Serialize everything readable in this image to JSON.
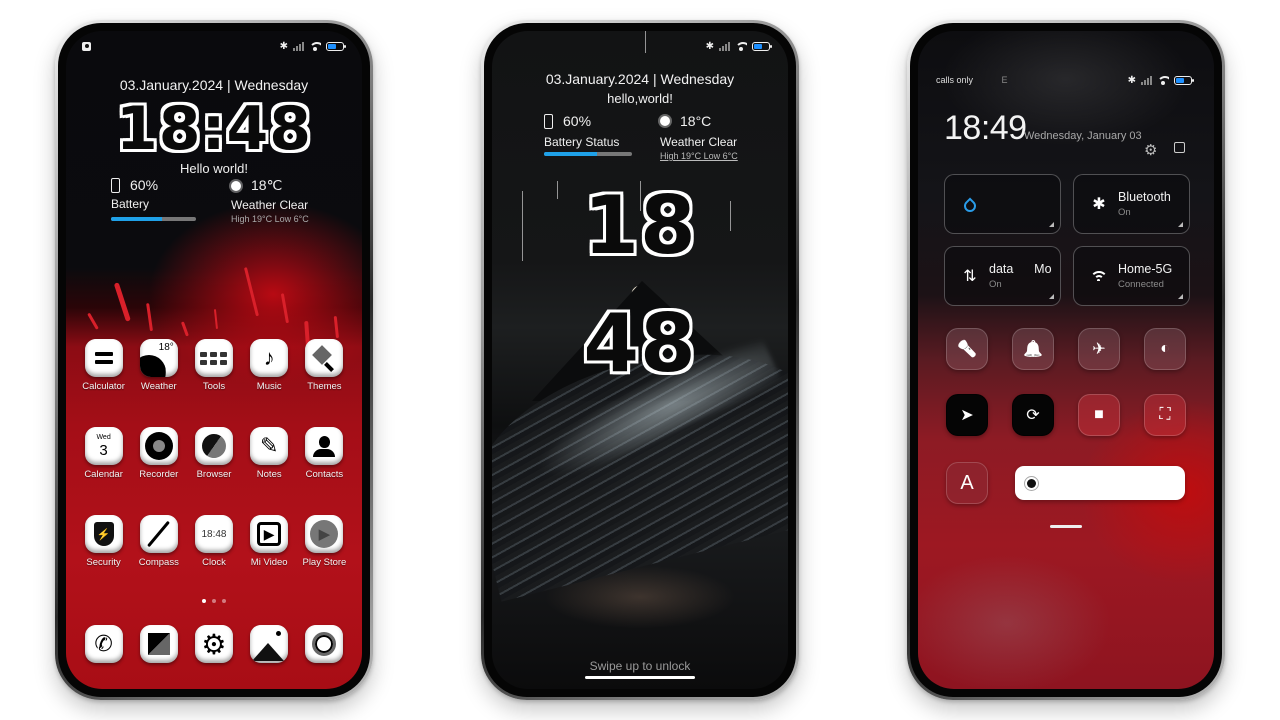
{
  "phones": {
    "home": {
      "date_line": "03.January.2024 | Wednesday",
      "time": {
        "hours": "18",
        "separator": ":",
        "minutes": "48"
      },
      "greeting": "Hello world!",
      "battery": {
        "percent_label": "60%",
        "label": "Battery",
        "level": 0.6
      },
      "weather": {
        "temp": "18℃",
        "condition": "Weather Clear",
        "high_low": "High 19°C  Low 6°C"
      },
      "apps": [
        {
          "label": "Calculator",
          "icon": "calculator-icon"
        },
        {
          "label": "Weather",
          "icon": "weather-icon",
          "badge": "18°"
        },
        {
          "label": "Tools",
          "icon": "tools-icon"
        },
        {
          "label": "Music",
          "icon": "music-icon",
          "glyph": "♪"
        },
        {
          "label": "Themes",
          "icon": "themes-icon"
        },
        {
          "label": "Calendar",
          "icon": "calendar-icon",
          "day": "Wed",
          "date": "3"
        },
        {
          "label": "Recorder",
          "icon": "recorder-icon"
        },
        {
          "label": "Browser",
          "icon": "browser-icon"
        },
        {
          "label": "Notes",
          "icon": "notes-icon",
          "glyph": "✎"
        },
        {
          "label": "Contacts",
          "icon": "contacts-icon"
        },
        {
          "label": "Security",
          "icon": "security-icon",
          "glyph": "⚡"
        },
        {
          "label": "Compass",
          "icon": "compass-icon"
        },
        {
          "label": "Clock",
          "icon": "clock-icon",
          "time": "18:48"
        },
        {
          "label": "Mi Video",
          "icon": "mi-video-icon",
          "glyph": "▶"
        },
        {
          "label": "Play Store",
          "icon": "play-store-icon",
          "glyph": "▶"
        }
      ],
      "page_dots": {
        "count": 3,
        "active": 0
      },
      "dock": [
        {
          "name": "phone",
          "icon": "phone-icon",
          "glyph": "✆"
        },
        {
          "name": "messages",
          "icon": "messages-icon"
        },
        {
          "name": "settings",
          "icon": "settings-icon",
          "glyph": "⚙"
        },
        {
          "name": "gallery",
          "icon": "gallery-icon"
        },
        {
          "name": "camera",
          "icon": "camera-icon"
        }
      ]
    },
    "lock": {
      "date_line": "03.January.2024 | Wednesday",
      "greeting": "hello,world!",
      "battery": {
        "percent_label": "60%",
        "label": "Battery Status",
        "level": 0.6
      },
      "weather": {
        "temp": "18°C",
        "condition": "Weather Clear",
        "high_low": "High 19°C  Low 6°C"
      },
      "time": {
        "hours": "18",
        "minutes": "48"
      },
      "unlock_hint": "Swipe up to unlock"
    },
    "control_center": {
      "carrier": "calls only",
      "network_type": "E",
      "time": "18:49",
      "date": "Wednesday, January 03",
      "tiles": [
        {
          "name": "data-saver",
          "icon": "water-drop-icon",
          "glyph": "💧",
          "title": "",
          "subtitle": ""
        },
        {
          "name": "bluetooth",
          "icon": "bluetooth-icon",
          "glyph": "✱",
          "title": "Bluetooth",
          "subtitle": "On"
        },
        {
          "name": "mobile-data",
          "icon": "data-arrows-icon",
          "glyph": "⇅",
          "title": "data      Mo",
          "subtitle": "On"
        },
        {
          "name": "wifi",
          "icon": "wifi-icon",
          "glyph": "◠",
          "title": "Home-5G",
          "subtitle": "Connected"
        }
      ],
      "toggles": [
        {
          "name": "flashlight",
          "icon": "flashlight-icon",
          "glyph": "🔦",
          "active": false
        },
        {
          "name": "notifications",
          "icon": "bell-icon",
          "glyph": "🔔",
          "active": false
        },
        {
          "name": "airplane-mode",
          "icon": "airplane-icon",
          "glyph": "✈",
          "active": false
        },
        {
          "name": "reading-mode",
          "icon": "contrast-icon",
          "glyph": "◐",
          "active": false
        },
        {
          "name": "location",
          "icon": "location-arrow-icon",
          "glyph": "➤",
          "active": true
        },
        {
          "name": "rotation-lock",
          "icon": "rotation-lock-icon",
          "glyph": "⟳",
          "active": true
        },
        {
          "name": "screen-record",
          "icon": "video-camera-icon",
          "glyph": "■",
          "active": false
        },
        {
          "name": "scanner",
          "icon": "scan-icon",
          "glyph": "⛶",
          "active": false
        }
      ],
      "auto_brightness_label": "A",
      "brightness_level": 0.05
    }
  },
  "status_bar": {
    "bluetooth_glyph": "✱",
    "battery_level": 0.6,
    "accent": "#1e90ff"
  },
  "colors": {
    "home_red": "#b2111a",
    "progress_blue": "#1fa1e8",
    "cc_red": "#9d1822"
  }
}
